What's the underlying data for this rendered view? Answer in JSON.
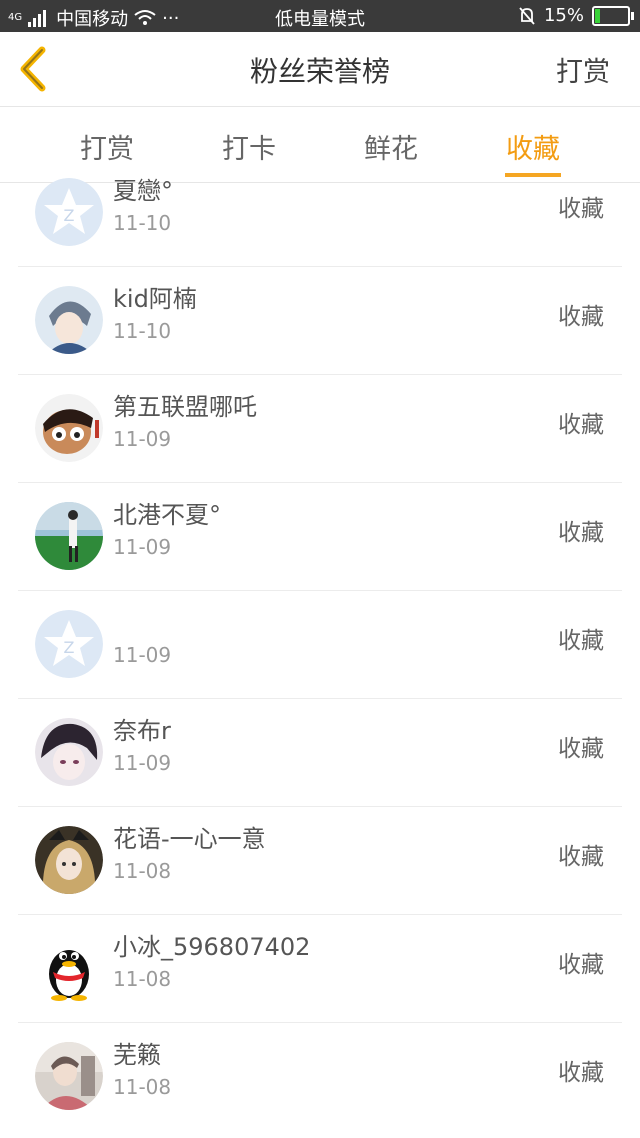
{
  "status_bar": {
    "network": "4G",
    "carrier": "中国移动",
    "dots": "···",
    "mode": "低电量模式",
    "battery": "15%",
    "battery_level": 0.15
  },
  "header": {
    "title": "粉丝荣誉榜",
    "action": "打赏"
  },
  "tabs": [
    {
      "label": "打赏",
      "active": false
    },
    {
      "label": "打卡",
      "active": false
    },
    {
      "label": "鲜花",
      "active": false
    },
    {
      "label": "收藏",
      "active": true
    }
  ],
  "colors": {
    "accent": "#f39c12"
  },
  "list": [
    {
      "name": "夏戀°",
      "date": "11-10",
      "action": "收藏",
      "avatar": "qq-star-default-icon"
    },
    {
      "name": "kid阿楠",
      "date": "11-10",
      "action": "收藏",
      "avatar": "anime-boy-avatar"
    },
    {
      "name": "第五联盟哪吒",
      "date": "11-09",
      "action": "收藏",
      "avatar": "nezha-avatar"
    },
    {
      "name": "北港不夏°",
      "date": "11-09",
      "action": "收藏",
      "avatar": "photo-avatar"
    },
    {
      "name": "",
      "date": "11-09",
      "action": "收藏",
      "avatar": "qq-star-default-icon"
    },
    {
      "name": "奈布r",
      "date": "11-09",
      "action": "收藏",
      "avatar": "anime-dark-avatar"
    },
    {
      "name": "花语-一心一意",
      "date": "11-08",
      "action": "收藏",
      "avatar": "anime-girl-avatar"
    },
    {
      "name": "小冰_596807402",
      "date": "11-08",
      "action": "收藏",
      "avatar": "qq-penguin-icon"
    },
    {
      "name": "芜籁",
      "date": "11-08",
      "action": "收藏",
      "avatar": "photo-avatar"
    }
  ]
}
